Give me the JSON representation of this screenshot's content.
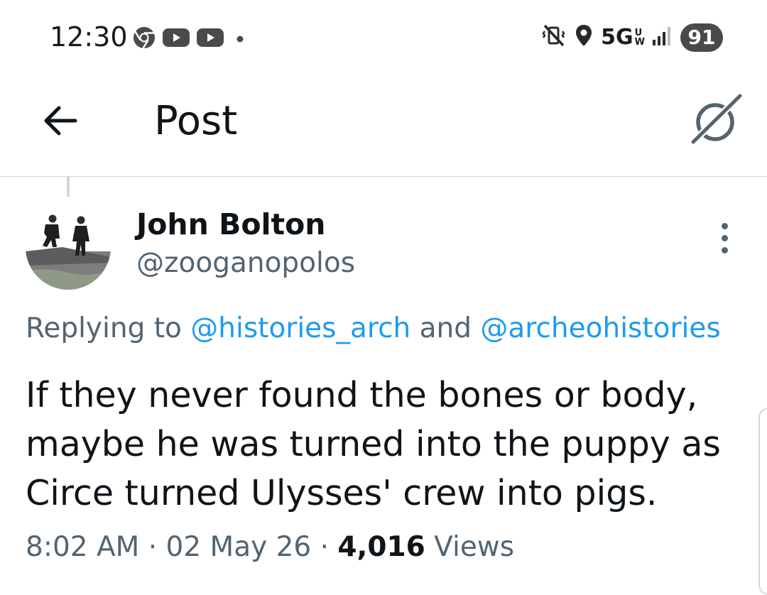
{
  "status_bar": {
    "time": "12:30",
    "network": "5G",
    "network_sub_top": "U",
    "network_sub_bottom": "W",
    "battery": "91",
    "icons_left": [
      "chrome-icon",
      "youtube-icon",
      "youtube-icon",
      "notification-dot-icon"
    ],
    "icons_right": [
      "mute-vibrate-icon",
      "location-icon",
      "signal-icon"
    ]
  },
  "header": {
    "title": "Post",
    "back_icon": "arrow-left-icon",
    "grok_icon": "grok-icon"
  },
  "post": {
    "author_name": "John Bolton",
    "author_handle": "@zooganopolos",
    "replying_prefix": "Replying to ",
    "mention_1": "@histories_arch",
    "replying_and": " and ",
    "mention_2": "@archeohistories",
    "text_lines": [
      "If they never found the bones or body,",
      "maybe he was turned into the puppy as",
      "Circe turned Ulysses' crew into pigs."
    ],
    "time": "8:02 AM",
    "separator": " · ",
    "date": "02 May 26",
    "views_count": "4,016",
    "views_label": " Views"
  },
  "colors": {
    "text": "#0f1419",
    "secondary": "#536471",
    "link": "#1d9bf0",
    "divider": "#cfd9de"
  }
}
